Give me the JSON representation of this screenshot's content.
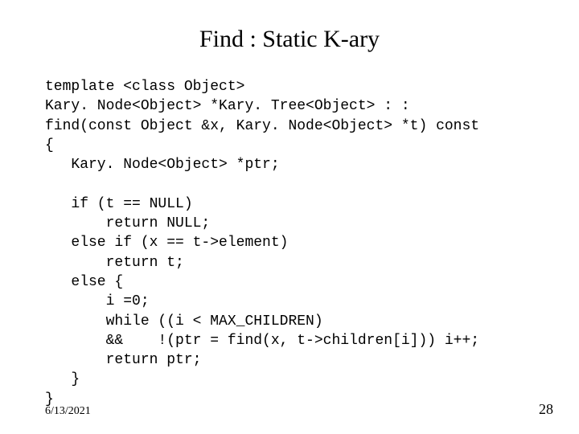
{
  "title": "Find : Static K-ary",
  "code": "template <class Object>\nKary. Node<Object> *Kary. Tree<Object> : :\nfind(const Object &x, Kary. Node<Object> *t) const\n{\n   Kary. Node<Object> *ptr;\n\n   if (t == NULL)\n       return NULL;\n   else if (x == t->element)\n       return t;\n   else {\n       i =0;\n       while ((i < MAX_CHILDREN)\n       &&    !(ptr = find(x, t->children[i])) i++;\n       return ptr;\n   }\n}",
  "footer": {
    "date": "6/13/2021",
    "page": "28"
  }
}
